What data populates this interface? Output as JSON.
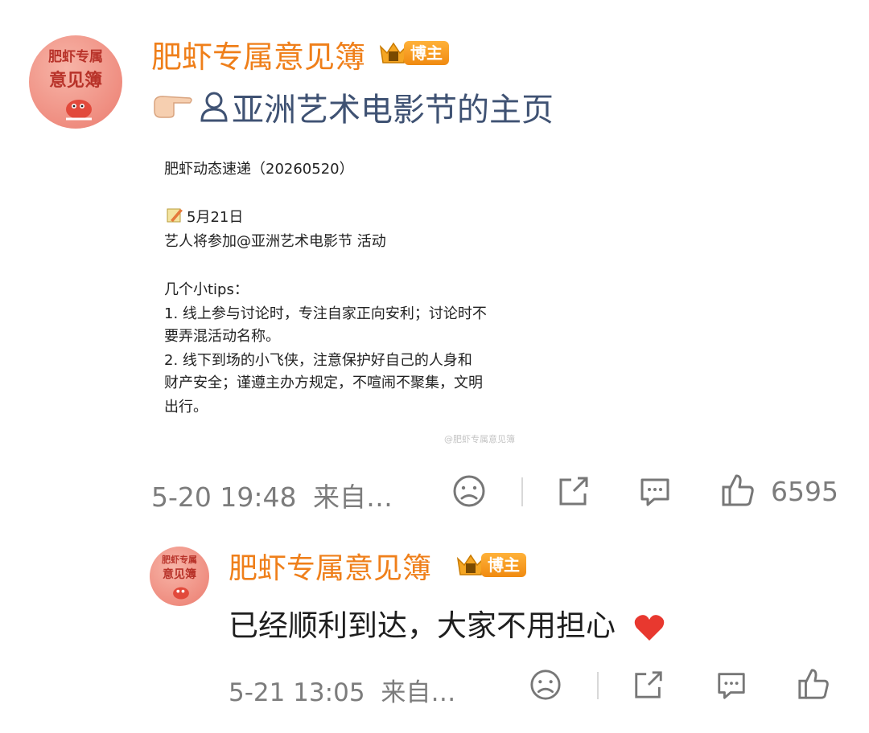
{
  "post": {
    "author": "肥虾专属意见簿",
    "badge": "博主",
    "avatar_text_top": "肥虾专属",
    "avatar_text_bottom": "意见簿",
    "link_text": "亚洲艺术电影节的主页",
    "image_lines": [
      "肥虾动态速递（20260520）",
      "",
      "5月21日",
      "艺人将参加@亚洲艺术电影节 活动",
      "",
      "几个小tips：",
      "1. 线上参与讨论时，专注自家正向安利；讨论时不",
      "要弄混活动名称。",
      "2. 线下到场的小飞侠，注意保护好自己的人身和",
      "财产安全；谨遵主办方规定，不喧闹不聚集，文明",
      "出行。"
    ],
    "watermark": "@肥虾专属意见簿",
    "timestamp": "5-20 19:48",
    "source": "来自…",
    "likes": "6595"
  },
  "comment": {
    "author": "肥虾专属意见簿",
    "badge": "博主",
    "avatar_text_top": "肥虾专属",
    "avatar_text_bottom": "意见簿",
    "text": "已经顺利到达，大家不用担心",
    "timestamp": "5-21 13:05",
    "source": "来自…"
  },
  "colors": {
    "name": "#ef7f1a",
    "link": "#3f5273",
    "meta": "#7c7c7c",
    "heart": "#e8382f"
  },
  "icons": [
    "pointing-hand-icon",
    "user-icon",
    "memo-icon",
    "frown-face-icon",
    "share-icon",
    "comment-icon",
    "thumbs-up-icon",
    "heart-icon"
  ]
}
